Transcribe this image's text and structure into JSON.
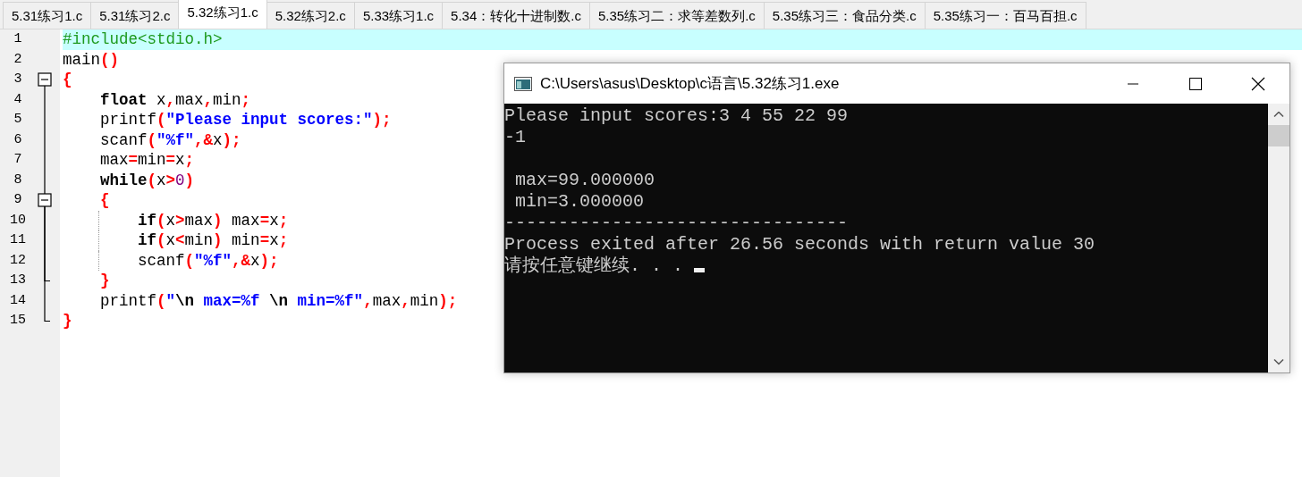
{
  "tabs": [
    {
      "label": "5.31练习1.c",
      "selected": false
    },
    {
      "label": "5.31练习2.c",
      "selected": false
    },
    {
      "label": "5.32练习1.c",
      "selected": true
    },
    {
      "label": "5.32练习2.c",
      "selected": false
    },
    {
      "label": "5.33练习1.c",
      "selected": false
    },
    {
      "label": "5.34：转化十进制数.c",
      "selected": false
    },
    {
      "label": "5.35练习二：求等差数列.c",
      "selected": false
    },
    {
      "label": "5.35练习三：食品分类.c",
      "selected": false
    },
    {
      "label": "5.35练习一：百马百担.c",
      "selected": false
    }
  ],
  "editor": {
    "lines": [
      {
        "number": "1",
        "selected": true,
        "guide": false,
        "tokens": [
          {
            "text": "#include<stdio.h>",
            "kind": "pre"
          }
        ]
      },
      {
        "number": "2",
        "selected": false,
        "guide": false,
        "tokens": [
          {
            "text": "main",
            "kind": "id"
          },
          {
            "text": "()",
            "kind": "op"
          }
        ]
      },
      {
        "number": "3",
        "selected": false,
        "expanded": true,
        "guide": false,
        "tokens": [
          {
            "text": "{",
            "kind": "op"
          }
        ]
      },
      {
        "number": "4",
        "selected": false,
        "guide": false,
        "tokens": [
          {
            "text": "    float",
            "kind": "kw"
          },
          {
            "text": " x",
            "kind": "id"
          },
          {
            "text": ",",
            "kind": "op"
          },
          {
            "text": "max",
            "kind": "id"
          },
          {
            "text": ",",
            "kind": "op"
          },
          {
            "text": "min",
            "kind": "id"
          },
          {
            "text": ";",
            "kind": "op"
          }
        ]
      },
      {
        "number": "5",
        "selected": false,
        "guide": false,
        "tokens": [
          {
            "text": "    printf",
            "kind": "id"
          },
          {
            "text": "(",
            "kind": "op"
          },
          {
            "text": "\"Please input scores:\"",
            "kind": "str"
          },
          {
            "text": ");",
            "kind": "op"
          }
        ]
      },
      {
        "number": "6",
        "selected": false,
        "guide": false,
        "tokens": [
          {
            "text": "    scanf",
            "kind": "id"
          },
          {
            "text": "(",
            "kind": "op"
          },
          {
            "text": "\"%f\"",
            "kind": "str"
          },
          {
            "text": ",&",
            "kind": "op"
          },
          {
            "text": "x",
            "kind": "id"
          },
          {
            "text": ");",
            "kind": "op"
          }
        ]
      },
      {
        "number": "7",
        "selected": false,
        "guide": false,
        "tokens": [
          {
            "text": "    max",
            "kind": "id"
          },
          {
            "text": "=",
            "kind": "op"
          },
          {
            "text": "min",
            "kind": "id"
          },
          {
            "text": "=",
            "kind": "op"
          },
          {
            "text": "x",
            "kind": "id"
          },
          {
            "text": ";",
            "kind": "op"
          }
        ]
      },
      {
        "number": "8",
        "selected": false,
        "guide": false,
        "tokens": [
          {
            "text": "    while",
            "kind": "kw"
          },
          {
            "text": "(",
            "kind": "op"
          },
          {
            "text": "x",
            "kind": "id"
          },
          {
            "text": ">",
            "kind": "op"
          },
          {
            "text": "0",
            "kind": "num"
          },
          {
            "text": ")",
            "kind": "op"
          }
        ]
      },
      {
        "number": "9",
        "selected": false,
        "expanded": true,
        "guide": false,
        "tokens": [
          {
            "text": "    {",
            "kind": "op"
          }
        ]
      },
      {
        "number": "10",
        "selected": false,
        "guide": true,
        "tokens": [
          {
            "text": "        if",
            "kind": "kw"
          },
          {
            "text": "(",
            "kind": "op"
          },
          {
            "text": "x",
            "kind": "id"
          },
          {
            "text": ">",
            "kind": "op"
          },
          {
            "text": "max",
            "kind": "id"
          },
          {
            "text": ")",
            "kind": "op"
          },
          {
            "text": " max",
            "kind": "id"
          },
          {
            "text": "=",
            "kind": "op"
          },
          {
            "text": "x",
            "kind": "id"
          },
          {
            "text": ";",
            "kind": "op"
          }
        ]
      },
      {
        "number": "11",
        "selected": false,
        "guide": true,
        "tokens": [
          {
            "text": "        if",
            "kind": "kw"
          },
          {
            "text": "(",
            "kind": "op"
          },
          {
            "text": "x",
            "kind": "id"
          },
          {
            "text": "<",
            "kind": "op"
          },
          {
            "text": "min",
            "kind": "id"
          },
          {
            "text": ")",
            "kind": "op"
          },
          {
            "text": " min",
            "kind": "id"
          },
          {
            "text": "=",
            "kind": "op"
          },
          {
            "text": "x",
            "kind": "id"
          },
          {
            "text": ";",
            "kind": "op"
          }
        ]
      },
      {
        "number": "12",
        "selected": false,
        "guide": true,
        "tokens": [
          {
            "text": "        scanf",
            "kind": "id"
          },
          {
            "text": "(",
            "kind": "op"
          },
          {
            "text": "\"%f\"",
            "kind": "str"
          },
          {
            "text": ",&",
            "kind": "op"
          },
          {
            "text": "x",
            "kind": "id"
          },
          {
            "text": ");",
            "kind": "op"
          }
        ]
      },
      {
        "number": "13",
        "selected": false,
        "fold_end": true,
        "guide": false,
        "tokens": [
          {
            "text": "    }",
            "kind": "op"
          }
        ]
      },
      {
        "number": "14",
        "selected": false,
        "guide": false,
        "tokens": [
          {
            "text": "    printf",
            "kind": "id"
          },
          {
            "text": "(",
            "kind": "op"
          },
          {
            "text": "\"",
            "kind": "str"
          },
          {
            "text": "\\n",
            "kind": "esc"
          },
          {
            "text": " max=%f ",
            "kind": "str"
          },
          {
            "text": "\\n",
            "kind": "esc"
          },
          {
            "text": " min=%f\"",
            "kind": "str"
          },
          {
            "text": ",",
            "kind": "op"
          },
          {
            "text": "max",
            "kind": "id"
          },
          {
            "text": ",",
            "kind": "op"
          },
          {
            "text": "min",
            "kind": "id"
          },
          {
            "text": ");",
            "kind": "op"
          }
        ]
      },
      {
        "number": "15",
        "selected": false,
        "fold_end": true,
        "guide": false,
        "tokens": [
          {
            "text": "}",
            "kind": "op"
          }
        ]
      }
    ]
  },
  "console": {
    "title": "C:\\Users\\asus\\Desktop\\c语言\\5.32练习1.exe",
    "lines": [
      {
        "kind": "text",
        "text": "Please input scores:3 4 55 22 99",
        "cursor": false
      },
      {
        "kind": "text",
        "text": "-1",
        "cursor": false
      },
      {
        "kind": "blank"
      },
      {
        "kind": "text",
        "text": " max=99.000000",
        "cursor": false
      },
      {
        "kind": "text",
        "text": " min=3.000000",
        "cursor": false
      },
      {
        "kind": "text",
        "text": "--------------------------------",
        "cursor": false
      },
      {
        "kind": "text",
        "text": "Process exited after 26.56 seconds with return value 30",
        "cursor": false
      },
      {
        "kind": "text",
        "text": "请按任意键继续. . .",
        "cursor": true
      }
    ]
  }
}
